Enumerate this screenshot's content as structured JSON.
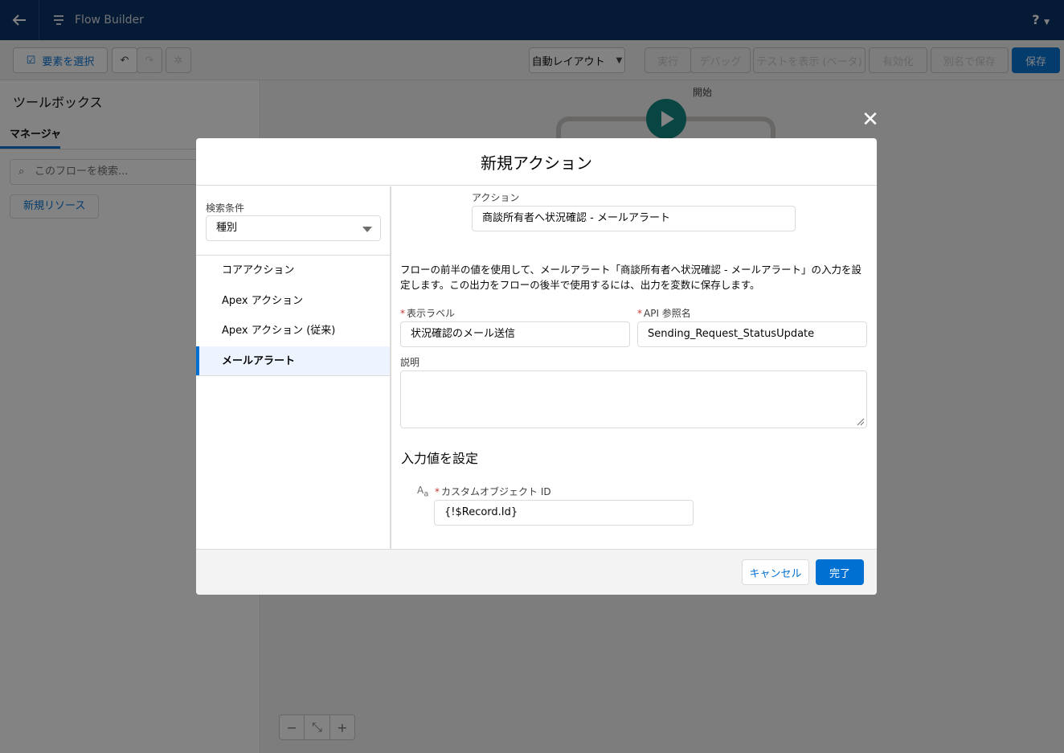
{
  "topbar": {
    "back_icon": "arrow-left-icon",
    "app_icon": "flow-icon",
    "app_title": "Flow Builder",
    "help_label": "?"
  },
  "toolbar": {
    "select_elements": "要素を選択",
    "undo_icon": "undo-icon",
    "redo_icon": "redo-icon",
    "settings_icon": "gear-icon",
    "auto_layout": "自動レイアウト",
    "run": "実行",
    "debug": "デバッグ",
    "view_tests": "テストを表示 (ベータ)",
    "activate": "有効化",
    "save_as": "別名で保存",
    "save": "保存"
  },
  "sidebar": {
    "title": "ツールボックス",
    "tab": "マネージャ",
    "search_placeholder": "このフローを検索...",
    "new_resource": "新規リソース"
  },
  "canvas": {
    "start_label": "開始",
    "zoom_out": "−",
    "zoom_fit": "⤡",
    "zoom_in": "+"
  },
  "modal": {
    "title": "新規アクション",
    "close_icon": "close-icon",
    "filter_label": "検索条件",
    "filter_value": "種別",
    "categories": [
      {
        "label": "コアアクション"
      },
      {
        "label": "Apex アクション"
      },
      {
        "label": "Apex アクション (従来)"
      },
      {
        "label": "メールアラート"
      }
    ],
    "action_label": "アクション",
    "action_value": "商談所有者へ状況確認 - メールアラート",
    "description_text": "フローの前半の値を使用して、メールアラート「商談所有者へ状況確認 - メールアラート」の入力を設定します。この出力をフローの後半で使用するには、出力を変数に保存します。",
    "display_label_label": "表示ラベル",
    "display_label_value": "状況確認のメール送信",
    "api_name_label": "API 参照名",
    "api_name_value": "Sending_Request_StatusUpdate",
    "description_label": "説明",
    "description_value": "",
    "inputs_title": "入力値を設定",
    "custom_object_id_label": "カスタムオブジェクト ID",
    "custom_object_id_value": "{!$Record.Id}",
    "cancel": "キャンセル",
    "done": "完了"
  }
}
